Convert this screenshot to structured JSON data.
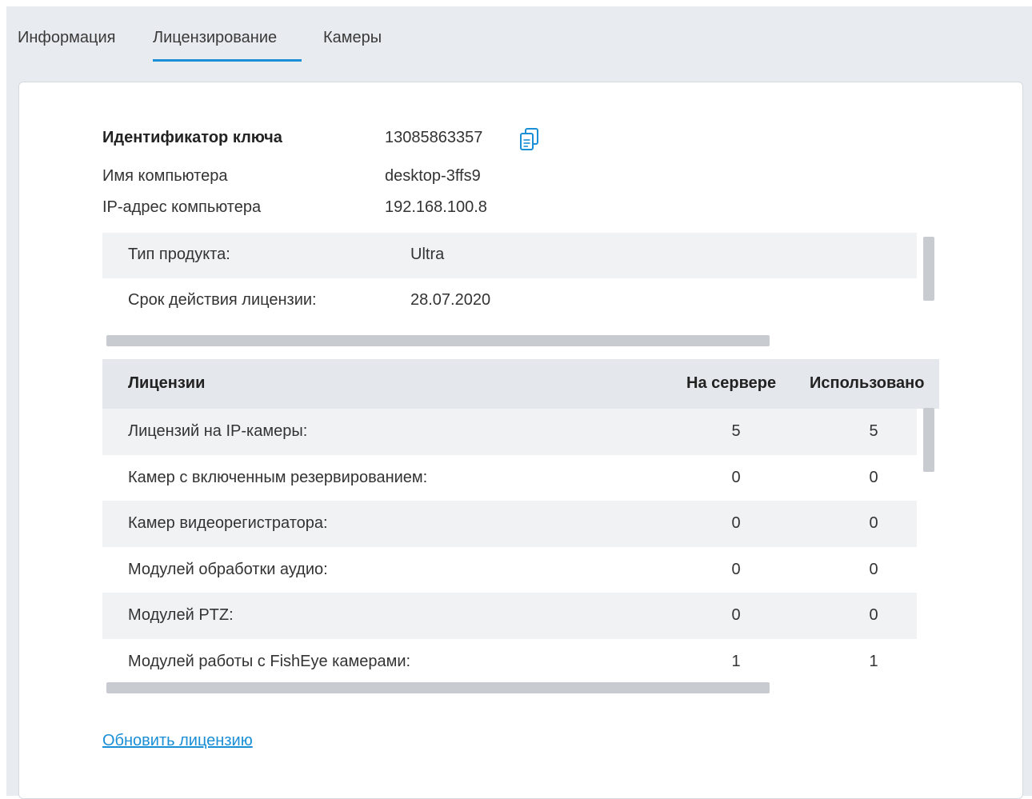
{
  "tabs": [
    {
      "label": "Информация"
    },
    {
      "label": "Лицензирование"
    },
    {
      "label": "Камеры"
    }
  ],
  "active_tab": "Лицензирование",
  "key_info": {
    "key_id_label": "Идентификатор ключа",
    "key_id_value": "13085863357",
    "computer_name_label": "Имя компьютера",
    "computer_name_value": "desktop-3ffs9",
    "ip_label": "IP-адрес компьютера",
    "ip_value": "192.168.100.8"
  },
  "product": {
    "rows": [
      {
        "label": "Тип продукта:",
        "value": "Ultra"
      },
      {
        "label": "Срок действия лицензии:",
        "value": "28.07.2020"
      }
    ]
  },
  "licenses": {
    "columns": {
      "name": "Лицензии",
      "server": "На сервере",
      "used": "Использовано"
    },
    "rows": [
      {
        "name": "Лицензий на IP-камеры:",
        "server": "5",
        "used": "5"
      },
      {
        "name": "Камер с включенным резервированием:",
        "server": "0",
        "used": "0"
      },
      {
        "name": "Камер видеорегистратора:",
        "server": "0",
        "used": "0"
      },
      {
        "name": "Модулей обработки аудио:",
        "server": "0",
        "used": "0"
      },
      {
        "name": "Модулей PTZ:",
        "server": "0",
        "used": "0"
      },
      {
        "name": "Модулей работы с FishEye камерами:",
        "server": "1",
        "used": "1"
      }
    ]
  },
  "update_link": "Обновить лицензию",
  "colors": {
    "accent": "#1a8fd6",
    "row_alt": "#f1f2f4",
    "header_bg": "#e4e7eb",
    "background": "#e8ebef"
  }
}
